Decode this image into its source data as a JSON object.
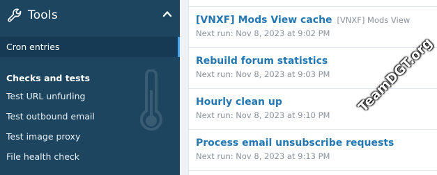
{
  "sidebar": {
    "section_title": "Tools",
    "items": [
      {
        "label": "Cron entries",
        "active": true
      }
    ],
    "group_heading": "Checks and tests",
    "group_items": [
      {
        "label": "Test URL unfurling"
      },
      {
        "label": "Test outbound email"
      },
      {
        "label": "Test image proxy"
      },
      {
        "label": "File health check"
      }
    ]
  },
  "cron_list": {
    "rows": [
      {
        "name": "[VNXF] Mods View cache",
        "addon": "[VNXF] Mods View",
        "next_run": "Next run: Nov 8, 2023 at 9:02 PM"
      },
      {
        "name": "Rebuild forum statistics",
        "addon": "",
        "next_run": "Next run: Nov 8, 2023 at 9:03 PM"
      },
      {
        "name": "Hourly clean up",
        "addon": "",
        "next_run": "Next run: Nov 8, 2023 at 9:10 PM"
      },
      {
        "name": "Process email unsubscribe requests",
        "addon": "",
        "next_run": "Next run: Nov 8, 2023 at 9:13 PM"
      }
    ]
  },
  "watermark": "TeamDGT.org",
  "colors": {
    "sidebar_bg": "#1d4560",
    "active_indicator": "#47a7eb",
    "link": "#2577b1",
    "muted": "#8a929a"
  }
}
